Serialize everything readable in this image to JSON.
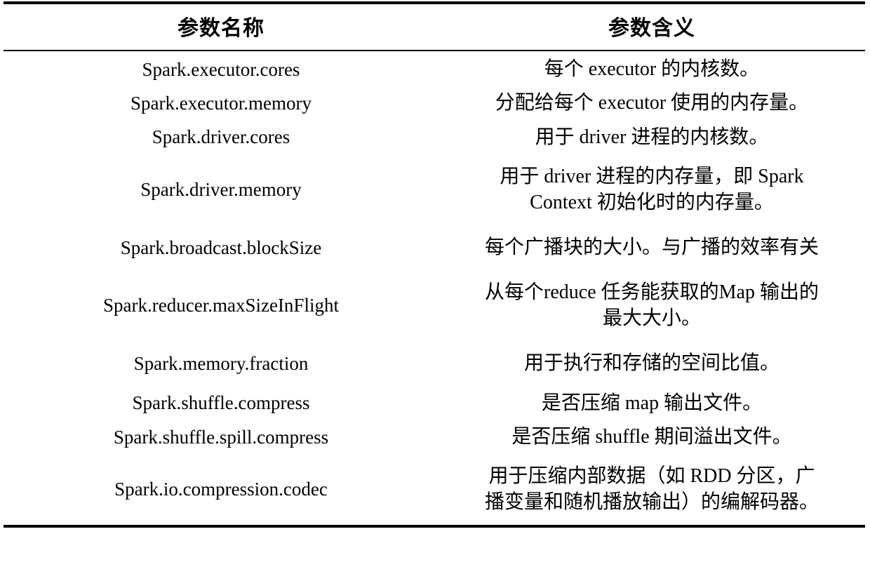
{
  "table": {
    "headers": {
      "name": "参数名称",
      "meaning": "参数含义"
    },
    "rows": [
      {
        "name": "Spark.executor.cores",
        "meaning_lines": [
          "每个 executor 的内核数。"
        ]
      },
      {
        "name": "Spark.executor.memory",
        "meaning_lines": [
          "分配给每个 executor 使用的内存量。"
        ]
      },
      {
        "name": "Spark.driver.cores",
        "meaning_lines": [
          "用于 driver 进程的内核数。"
        ]
      },
      {
        "name": "Spark.driver.memory",
        "meaning_lines": [
          "用于 driver 进程的内存量，即 Spark",
          "Context 初始化时的内存量。"
        ]
      },
      {
        "name": "Spark.broadcast.blockSize",
        "meaning_lines": [
          "每个广播块的大小。与广播的效率有关"
        ]
      },
      {
        "name": "Spark.reducer.maxSizeInFlight",
        "meaning_lines": [
          "从每个reduce 任务能获取的Map 输出的",
          "最大大小。"
        ]
      },
      {
        "name": "Spark.memory.fraction",
        "meaning_lines": [
          "用于执行和存储的空间比值。"
        ]
      },
      {
        "name": "Spark.shuffle.compress",
        "meaning_lines": [
          "是否压缩 map 输出文件。"
        ]
      },
      {
        "name": "Spark.shuffle.spill.compress",
        "meaning_lines": [
          "是否压缩 shuffle 期间溢出文件。"
        ]
      },
      {
        "name": "Spark.io.compression.codec",
        "meaning_lines": [
          "用于压缩内部数据（如 RDD 分区，广",
          "播变量和随机播放输出）的编解码器。"
        ]
      }
    ]
  }
}
